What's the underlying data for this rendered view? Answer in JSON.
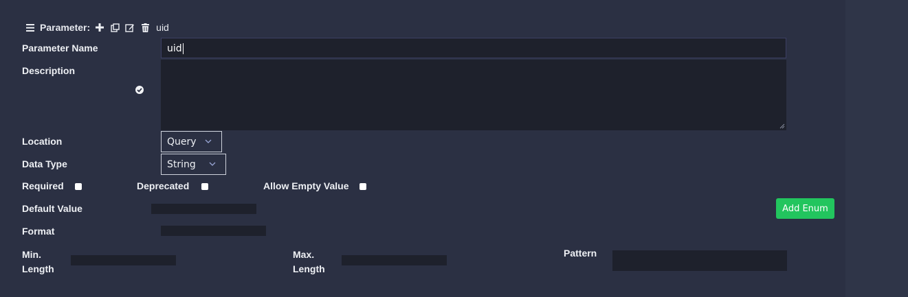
{
  "header": {
    "title": "Parameter:",
    "param_name": "uid"
  },
  "fields": {
    "name_label": "Parameter Name",
    "name_value": "uid",
    "description_label": "Description",
    "location_label": "Location",
    "location_value": "Query",
    "datatype_label": "Data Type",
    "datatype_value": "String",
    "required_label": "Required",
    "deprecated_label": "Deprecated",
    "allow_empty_label": "Allow Empty Value",
    "default_label": "Default Value",
    "format_label": "Format",
    "min_length_label_1": "Min.",
    "min_length_label_2": "Length",
    "max_length_label_1": "Max.",
    "max_length_label_2": "Length",
    "pattern_label": "Pattern"
  },
  "buttons": {
    "add_enum": "Add Enum"
  },
  "colors": {
    "background": "#2b3043",
    "input_bg": "#1e212c",
    "accent_green": "#22c55e"
  }
}
